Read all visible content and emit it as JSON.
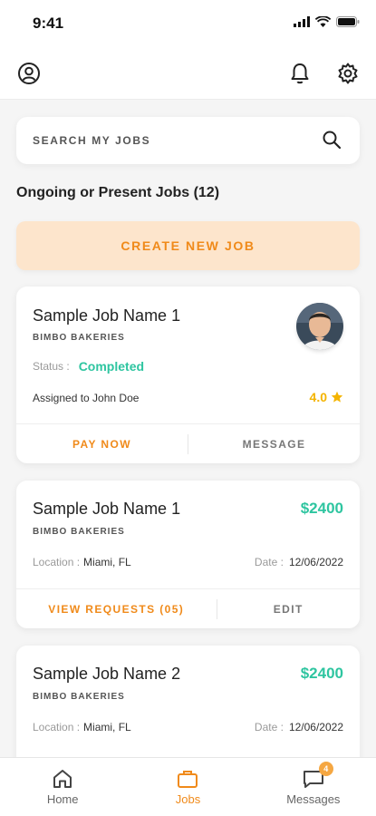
{
  "status_bar": {
    "time": "9:41"
  },
  "search": {
    "placeholder": "SEARCH MY JOBS"
  },
  "section": {
    "title": "Ongoing or Present Jobs (12)"
  },
  "create_button": {
    "label": "CREATE NEW JOB"
  },
  "jobs": [
    {
      "name": "Sample Job Name 1",
      "company": "BIMBO BAKERIES",
      "status_label": "Status :",
      "status_value": "Completed",
      "assigned": "Assigned to John Doe",
      "rating": "4.0",
      "actions": [
        "PAY NOW",
        "MESSAGE"
      ]
    },
    {
      "name": "Sample Job Name 1",
      "company": "BIMBO BAKERIES",
      "price": "$2400",
      "location_label": "Location :",
      "location_value": "Miami, FL",
      "date_label": "Date :",
      "date_value": "12/06/2022",
      "actions": [
        "VIEW REQUESTS (05)",
        "EDIT"
      ]
    },
    {
      "name": "Sample Job Name 2",
      "company": "BIMBO BAKERIES",
      "price": "$2400",
      "location_label": "Location :",
      "location_value": "Miami, FL",
      "date_label": "Date :",
      "date_value": "12/06/2022"
    }
  ],
  "bottom_nav": {
    "items": [
      {
        "label": "Home",
        "icon": "home-icon"
      },
      {
        "label": "Jobs",
        "icon": "briefcase-icon",
        "active": true
      },
      {
        "label": "Messages",
        "icon": "chat-icon",
        "badge": "4"
      }
    ]
  },
  "colors": {
    "accent": "#f08a1a",
    "success": "#2ec5a0",
    "rating": "#f4b400",
    "create_bg": "#fde5cc"
  }
}
